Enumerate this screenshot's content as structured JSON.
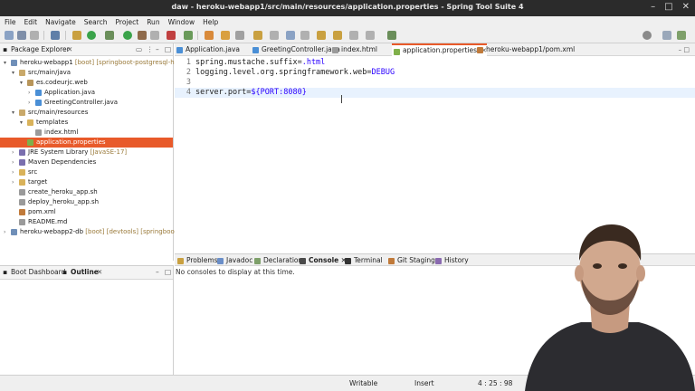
{
  "window": {
    "title": "daw - heroku-webapp1/src/main/resources/application.properties - Spring Tool Suite 4"
  },
  "menu": [
    "File",
    "Edit",
    "Navigate",
    "Search",
    "Project",
    "Run",
    "Window",
    "Help"
  ],
  "explorer": {
    "tab_label": "Package Explorer",
    "tree": [
      {
        "arrow": "▾",
        "label": "heroku-webapp1",
        "decoration": " [boot] [springboot-postgresql-herok",
        "icon": "#6f8fb8",
        "indent": 0
      },
      {
        "arrow": "▾",
        "label": "src/main/java",
        "decoration": "",
        "icon": "#c9a96a",
        "indent": 1
      },
      {
        "arrow": "▾",
        "label": "es.codeurjc.web",
        "decoration": "",
        "icon": "#b8955a",
        "indent": 2
      },
      {
        "arrow": "›",
        "label": "Application.java",
        "decoration": "",
        "icon": "#4a8fd6",
        "indent": 3
      },
      {
        "arrow": "›",
        "label": "GreetingController.java",
        "decoration": "",
        "icon": "#4a8fd6",
        "indent": 3
      },
      {
        "arrow": "▾",
        "label": "src/main/resources",
        "decoration": "",
        "icon": "#c9a96a",
        "indent": 1
      },
      {
        "arrow": "▾",
        "label": "templates",
        "decoration": "",
        "icon": "#d9b25a",
        "indent": 2
      },
      {
        "arrow": "",
        "label": "index.html",
        "decoration": "",
        "icon": "#9a9a9a",
        "indent": 3
      },
      {
        "arrow": "",
        "label": "application.properties",
        "decoration": "",
        "icon": "#7fb04a",
        "indent": 2,
        "selected": true
      },
      {
        "arrow": "›",
        "label": "JRE System Library",
        "decoration": " [JavaSE-17]",
        "icon": "#7a6fae",
        "indent": 1
      },
      {
        "arrow": "›",
        "label": "Maven Dependencies",
        "decoration": "",
        "icon": "#7a6fae",
        "indent": 1
      },
      {
        "arrow": "›",
        "label": "src",
        "decoration": "",
        "icon": "#d9b25a",
        "indent": 1
      },
      {
        "arrow": "›",
        "label": "target",
        "decoration": "",
        "icon": "#d9b25a",
        "indent": 1
      },
      {
        "arrow": "",
        "label": "create_heroku_app.sh",
        "decoration": "",
        "icon": "#9a9a9a",
        "indent": 1
      },
      {
        "arrow": "",
        "label": "deploy_heroku_app.sh",
        "decoration": "",
        "icon": "#9a9a9a",
        "indent": 1
      },
      {
        "arrow": "",
        "label": "pom.xml",
        "decoration": "",
        "icon": "#c07a3a",
        "indent": 1
      },
      {
        "arrow": "",
        "label": "README.md",
        "decoration": "",
        "icon": "#9a9a9a",
        "indent": 1
      },
      {
        "arrow": "›",
        "label": "heroku-webapp2-db",
        "decoration": " [boot] [devtools] [springboot-po",
        "icon": "#6f8fb8",
        "indent": 0
      }
    ]
  },
  "bottom_left": {
    "tab1": "Boot Dashboard",
    "tab2": "Outline"
  },
  "editor": {
    "tabs": [
      {
        "label": "Application.java",
        "icon": "#4a8fd6"
      },
      {
        "label": "GreetingController.java",
        "icon": "#4a8fd6"
      },
      {
        "label": "index.html",
        "icon": "#9a9a9a"
      },
      {
        "label": "application.properties",
        "icon": "#7fb04a",
        "active": true
      },
      {
        "label": "heroku-webapp1/pom.xml",
        "icon": "#c07a3a"
      }
    ],
    "lines": [
      {
        "num": "1",
        "key": "spring.mustache.suffix=",
        "value": ".html"
      },
      {
        "num": "2",
        "key": "logging.level.org.springframework.web=",
        "value": "DEBUG"
      },
      {
        "num": "3",
        "key": "",
        "value": ""
      },
      {
        "num": "4",
        "key": "server.port=",
        "value": "${PORT:8080}"
      }
    ]
  },
  "console": {
    "tabs": [
      "Problems",
      "Javadoc",
      "Declaration",
      "Console",
      "Terminal",
      "Git Staging",
      "History"
    ],
    "active": "Console",
    "message": "No consoles to display at this time."
  },
  "status": {
    "writable": "Writable",
    "insert": "Insert",
    "position": "4 : 25 : 98"
  },
  "colors": {
    "accent": "#e85a2a",
    "titlebar": "#2b2b2b",
    "value": "#2a00ff"
  }
}
